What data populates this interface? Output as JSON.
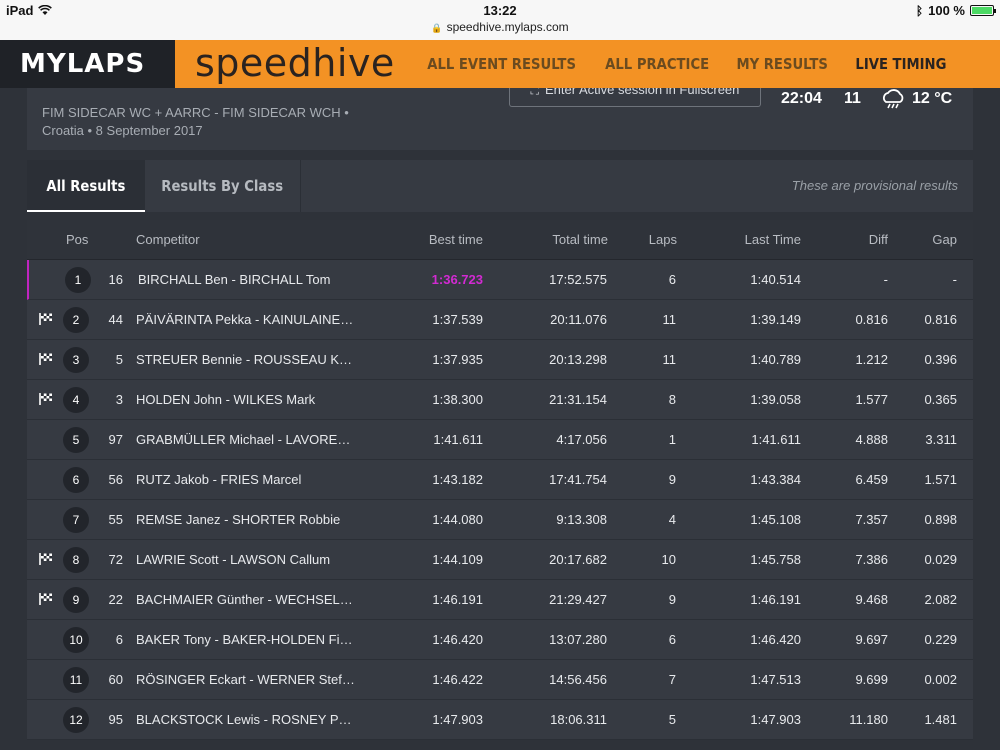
{
  "statusbar": {
    "device": "iPad",
    "time": "13:22",
    "url": "speedhive.mylaps.com",
    "battery": "100 %"
  },
  "header": {
    "logo": "MYLAPS",
    "brand": "speedhive",
    "nav": [
      {
        "label": "ALL EVENT RESULTS",
        "active": false
      },
      {
        "label": "ALL PRACTICE",
        "active": false
      },
      {
        "label": "MY RESULTS",
        "active": false
      },
      {
        "label": "LIVE TIMING",
        "active": true
      }
    ]
  },
  "event": {
    "title_line1": "FIM SIDECAR WC + AARRC - FIM SIDECAR WCH •",
    "title_line2": "Croatia • 8 September 2017",
    "fullscreen_label": "Enter Active session in Fullscreen",
    "clock": "22:04",
    "count": "11",
    "temperature": "12 °C"
  },
  "tabs": {
    "all_results": "All Results",
    "results_by_class": "Results By Class",
    "provisional_note": "These are provisional results"
  },
  "table": {
    "headers": {
      "pos": "Pos",
      "competitor": "Competitor",
      "best_time": "Best time",
      "total_time": "Total time",
      "laps": "Laps",
      "last_time": "Last Time",
      "diff": "Diff",
      "gap": "Gap"
    },
    "rows": [
      {
        "pos": "1",
        "num": "16",
        "name": "BIRCHALL Ben - BIRCHALL Tom",
        "best": "1:36.723",
        "total": "17:52.575",
        "laps": "6",
        "last": "1:40.514",
        "diff": "-",
        "gap": "-",
        "flag": false,
        "fastest": true
      },
      {
        "pos": "2",
        "num": "44",
        "name": "PÄIVÄRINTA Pekka - KAINULAINE…",
        "best": "1:37.539",
        "total": "20:11.076",
        "laps": "11",
        "last": "1:39.149",
        "diff": "0.816",
        "gap": "0.816",
        "flag": true,
        "fastest": false
      },
      {
        "pos": "3",
        "num": "5",
        "name": "STREUER Bennie - ROUSSEAU K…",
        "best": "1:37.935",
        "total": "20:13.298",
        "laps": "11",
        "last": "1:40.789",
        "diff": "1.212",
        "gap": "0.396",
        "flag": true,
        "fastest": false
      },
      {
        "pos": "4",
        "num": "3",
        "name": "HOLDEN John - WILKES Mark",
        "best": "1:38.300",
        "total": "21:31.154",
        "laps": "8",
        "last": "1:39.058",
        "diff": "1.577",
        "gap": "0.365",
        "flag": true,
        "fastest": false
      },
      {
        "pos": "5",
        "num": "97",
        "name": "GRABMÜLLER Michael - LAVORE…",
        "best": "1:41.611",
        "total": "4:17.056",
        "laps": "1",
        "last": "1:41.611",
        "diff": "4.888",
        "gap": "3.311",
        "flag": false,
        "fastest": false
      },
      {
        "pos": "6",
        "num": "56",
        "name": "RUTZ Jakob - FRIES Marcel",
        "best": "1:43.182",
        "total": "17:41.754",
        "laps": "9",
        "last": "1:43.384",
        "diff": "6.459",
        "gap": "1.571",
        "flag": false,
        "fastest": false
      },
      {
        "pos": "7",
        "num": "55",
        "name": "REMSE Janez - SHORTER Robbie",
        "best": "1:44.080",
        "total": "9:13.308",
        "laps": "4",
        "last": "1:45.108",
        "diff": "7.357",
        "gap": "0.898",
        "flag": false,
        "fastest": false
      },
      {
        "pos": "8",
        "num": "72",
        "name": "LAWRIE Scott - LAWSON Callum",
        "best": "1:44.109",
        "total": "20:17.682",
        "laps": "10",
        "last": "1:45.758",
        "diff": "7.386",
        "gap": "0.029",
        "flag": true,
        "fastest": false
      },
      {
        "pos": "9",
        "num": "22",
        "name": "BACHMAIER Günther - WECHSEL…",
        "best": "1:46.191",
        "total": "21:29.427",
        "laps": "9",
        "last": "1:46.191",
        "diff": "9.468",
        "gap": "2.082",
        "flag": true,
        "fastest": false
      },
      {
        "pos": "10",
        "num": "6",
        "name": "BAKER Tony - BAKER-HOLDEN Fi…",
        "best": "1:46.420",
        "total": "13:07.280",
        "laps": "6",
        "last": "1:46.420",
        "diff": "9.697",
        "gap": "0.229",
        "flag": false,
        "fastest": false
      },
      {
        "pos": "11",
        "num": "60",
        "name": "RÖSINGER Eckart - WERNER Stef…",
        "best": "1:46.422",
        "total": "14:56.456",
        "laps": "7",
        "last": "1:47.513",
        "diff": "9.699",
        "gap": "0.002",
        "flag": false,
        "fastest": false
      },
      {
        "pos": "12",
        "num": "95",
        "name": "BLACKSTOCK Lewis - ROSNEY P…",
        "best": "1:47.903",
        "total": "18:06.311",
        "laps": "5",
        "last": "1:47.903",
        "diff": "11.180",
        "gap": "1.481",
        "flag": false,
        "fastest": false
      }
    ]
  },
  "colors": {
    "brand_orange": "#f39224",
    "fastest_purple": "#d22ad2",
    "battery_green": "#4cd964"
  }
}
